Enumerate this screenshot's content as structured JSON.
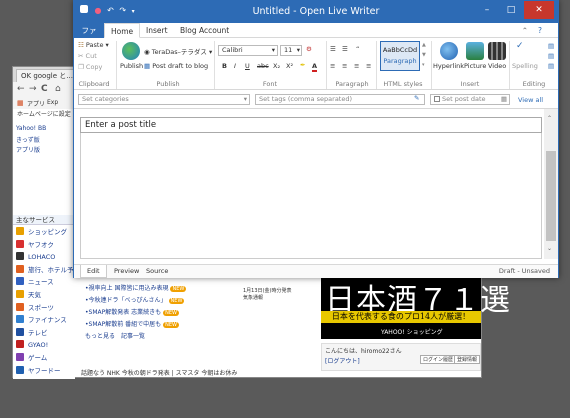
{
  "browser": {
    "tab_title": "OK google と...",
    "nav": {
      "back": "←",
      "forward": "→",
      "reload": "C",
      "home": "⌂"
    },
    "bookmarks": [
      "アプリ",
      "Exp"
    ],
    "home_label": "ホームページに設定",
    "left_links": [
      "Yahoo! BB",
      "きっず版",
      "アプリ版"
    ],
    "services_header": "主なサービス",
    "services": [
      {
        "label": "ショッピング",
        "color": "#e8a000"
      },
      {
        "label": "ヤフオク",
        "color": "#d83030"
      },
      {
        "label": "LOHACO",
        "color": "#333333"
      },
      {
        "label": "旅行、ホテル予約",
        "color": "#e06020"
      },
      {
        "label": "ニュース",
        "color": "#3060c0"
      },
      {
        "label": "天気",
        "color": "#e8a000"
      },
      {
        "label": "スポーツ",
        "color": "#e06020"
      },
      {
        "label": "ファイナンス",
        "color": "#3080d0"
      },
      {
        "label": "テレビ",
        "color": "#2050a0"
      },
      {
        "label": "GYAO!",
        "color": "#c02020"
      },
      {
        "label": "ゲーム",
        "color": "#8040b0"
      },
      {
        "label": "ヤフードー",
        "color": "#2060b0"
      }
    ],
    "news": [
      "•視率向上 国際皆に用込み表現",
      "•今秋連ドラ「べっぴんさん」",
      "•SMAP解散発表 志業続きも",
      "•SMAP解散前 番組で中居も",
      "もっと見る　記事一覧"
    ],
    "news_new": "NEW",
    "center_info": [
      "1月13日(金)時分発表",
      "気象通報"
    ],
    "ad": {
      "headline": "日本酒７１選",
      "sub": "日本を代表する食のプロ14人が厳選！",
      "logo": "YAHOO! ショッピング"
    },
    "user": {
      "greeting": "こんにちは、hiromo22さん",
      "logout": "[ログアウト]",
      "btn1": "ログイン履歴",
      "btn2": "登録情報"
    },
    "bottom_news": "話題なう  NHK 今秋の朝ドラ発表 | スマスタ 今朝はお休み"
  },
  "writer": {
    "title": "Untitled - Open Live Writer",
    "controls": {
      "minimize": "–",
      "maximize": "□",
      "close": "✕"
    },
    "menu": {
      "file": "ファイル",
      "home": "Home",
      "insert": "Insert",
      "blog_account": "Blog Account",
      "help": "?"
    },
    "ribbon": {
      "paste": "Paste",
      "cut": "Cut",
      "copy": "Copy",
      "clipboard": "Clipboard",
      "publish": "Publish",
      "blog_name": "TeraDas–テラダス",
      "publish_draft": "Post draft to blog",
      "publish_group": "Publish",
      "font_name": "Calibri",
      "font_size": "11",
      "bold": "B",
      "italic": "I",
      "underline": "U",
      "strike": "abc",
      "sub": "X₂",
      "sup": "X²",
      "font_group": "Font",
      "paragraph_group": "Paragraph",
      "style_sample": "AaBbCcDd",
      "style_name": "Paragraph",
      "html_group": "HTML styles",
      "hyperlink": "Hyperlink",
      "picture": "Picture",
      "video": "Video",
      "insert_group": "Insert",
      "spelling": "Spelling",
      "editing_group": "Editing"
    },
    "categories_placeholder": "Set categories",
    "tags_placeholder": "Set tags (comma separated)",
    "post_date": "Set post date",
    "view_all": "View all",
    "post_title_placeholder": "Enter a post title",
    "views": [
      "Edit",
      "Preview",
      "Source"
    ],
    "status": "Draft - Unsaved",
    "accent": "#2d6bb5",
    "close_color": "#c7372c"
  }
}
